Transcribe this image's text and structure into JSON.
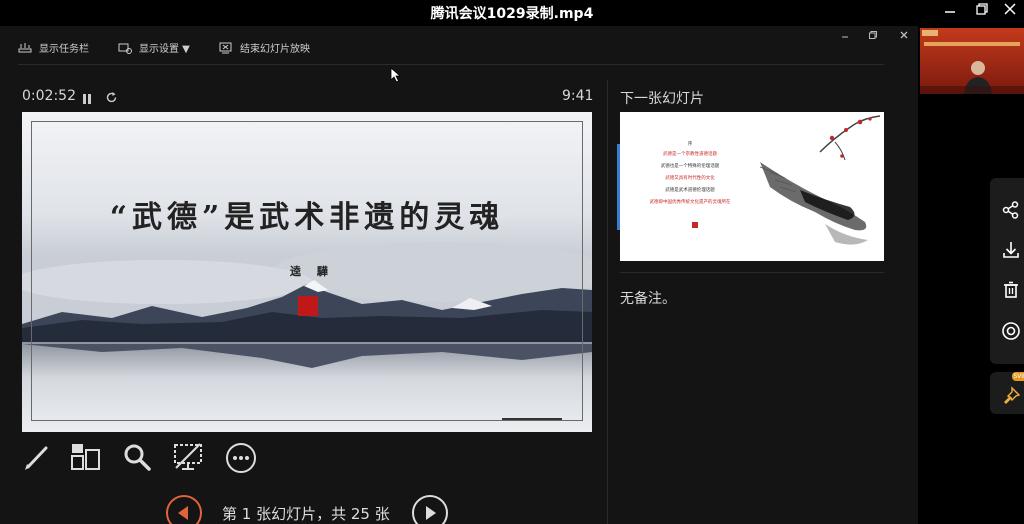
{
  "window": {
    "title": "腾讯会议1029录制.mp4"
  },
  "toolbar": {
    "show_taskbar": "显示任务栏",
    "display_settings": "显示设置 ▼",
    "end_slideshow": "结束幻灯片放映"
  },
  "presenter": {
    "timer": "0:02:52",
    "clock": "9:41",
    "next_slide_label": "下一张幻灯片",
    "notes": "无备注。",
    "slide_counter": "第 1 张幻灯片，共 25 张"
  },
  "current_slide": {
    "title": "“武德”是武术非遗的灵魂",
    "author": "逵 驊"
  },
  "next_slide": {
    "heading": "序",
    "lines": [
      "武德是一个宗教性道德话题",
      "武德也是一个特殊的伦理话题",
      "武德又具有时代性的文化",
      "武德是武术道德伦理话题",
      "武德即中国优秀传统文化遗产的灵魂所在"
    ]
  },
  "colors": {
    "accent_orange": "#e0633a",
    "next_bar_blue": "#3c7bd4",
    "seal_red": "#c01818",
    "badge_orange": "#e39a25"
  },
  "side_panel": {
    "badge": "SVIP"
  }
}
